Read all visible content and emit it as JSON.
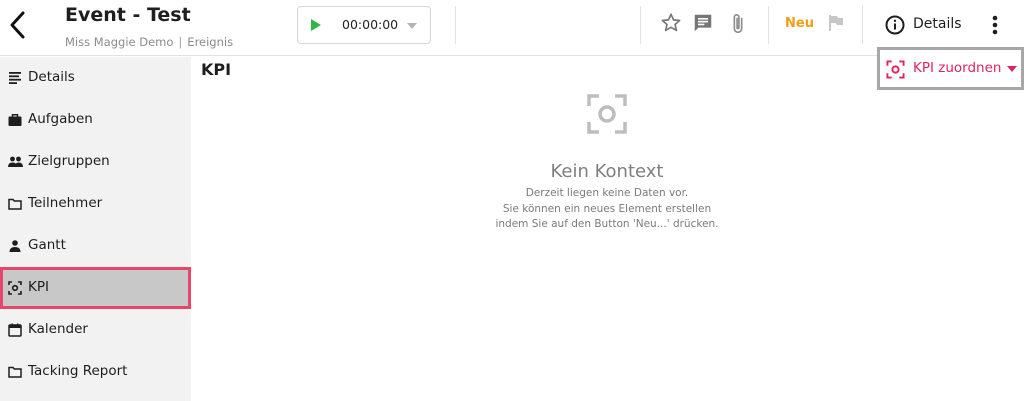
{
  "header": {
    "title": "Event - Test",
    "owner": "Miss Maggie Demo",
    "separator": "|",
    "type": "Ereignis",
    "timer": {
      "value": "00:00:00"
    },
    "new_label": "Neu",
    "details_label": "Details",
    "colors": {
      "accent_new": "#f0a017",
      "play": "#2db84b"
    }
  },
  "sidebar": {
    "items": [
      {
        "label": "Details",
        "icon": "list-icon"
      },
      {
        "label": "Aufgaben",
        "icon": "briefcase-icon"
      },
      {
        "label": "Zielgruppen",
        "icon": "people-icon"
      },
      {
        "label": "Teilnehmer",
        "icon": "folder-icon"
      },
      {
        "label": "Gantt",
        "icon": "person-icon"
      },
      {
        "label": "KPI",
        "icon": "kpi-icon",
        "active": true
      },
      {
        "label": "Kalender",
        "icon": "calendar-icon"
      },
      {
        "label": "Tacking Report",
        "icon": "folder-icon"
      }
    ]
  },
  "main": {
    "title": "KPI",
    "assign_button": {
      "label": "KPI zuordnen",
      "color": "#e0245e"
    },
    "empty": {
      "title": "Kein Kontext",
      "line1": "Derzeit liegen keine Daten vor.",
      "line2": "Sie können ein neues Element erstellen",
      "line3": "indem Sie auf den Button 'Neu...' drücken."
    }
  }
}
